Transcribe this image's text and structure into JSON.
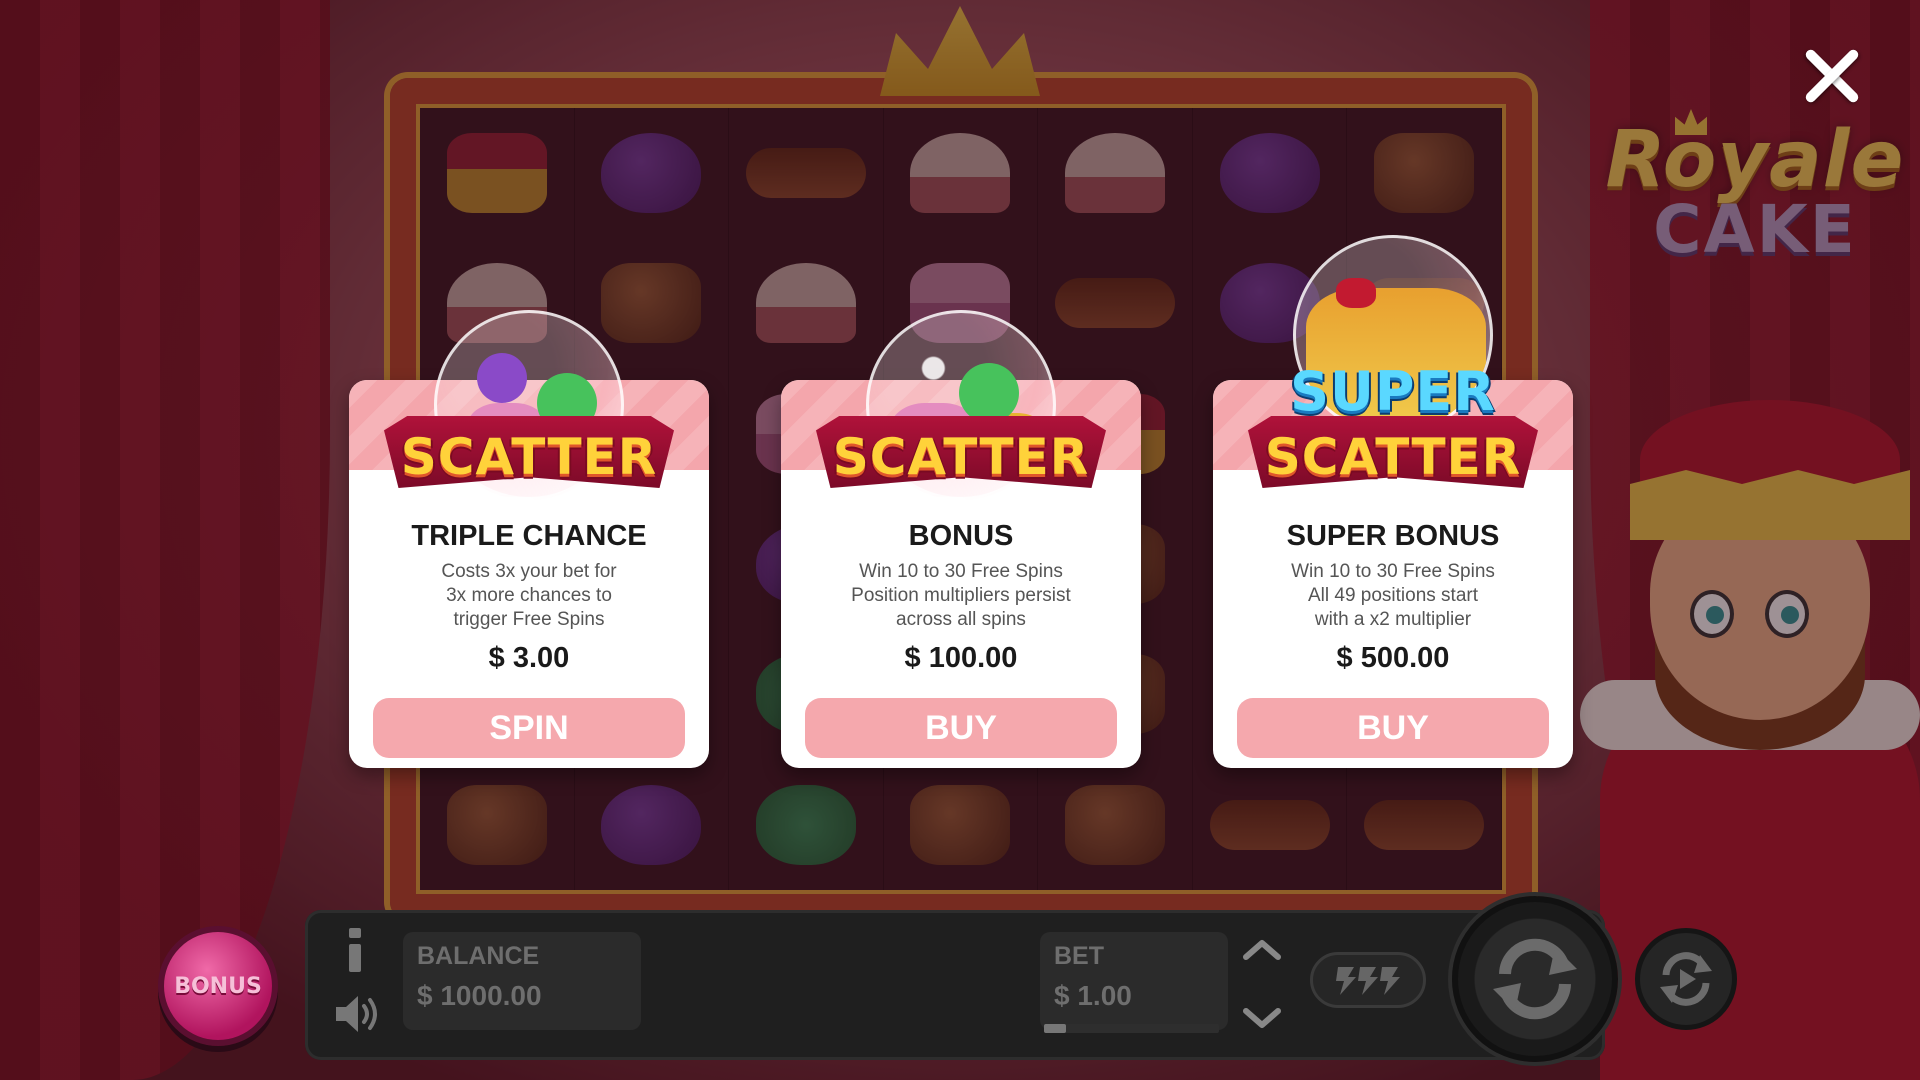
{
  "game": {
    "logo_line1": "Royale",
    "logo_line2": "CAKE"
  },
  "popup": {
    "close_icon": "close-icon",
    "cards": [
      {
        "badge": "SCATTER",
        "title": "TRIPLE CHANCE",
        "description_lines": [
          "Costs 3x your bet for",
          "3x more chances to",
          "trigger Free Spins"
        ],
        "price": "$ 3.00",
        "action_label": "SPIN"
      },
      {
        "badge": "SCATTER",
        "title": "BONUS",
        "description_lines": [
          "Win 10 to 30 Free Spins",
          "Position multipliers persist",
          "across all spins"
        ],
        "price": "$ 100.00",
        "action_label": "BUY"
      },
      {
        "badge_top": "SUPER",
        "badge": "SCATTER",
        "title": "SUPER BONUS",
        "description_lines": [
          "Win 10 to 30 Free Spins",
          "All 49 positions start",
          "with a x2 multiplier"
        ],
        "price": "$ 500.00",
        "action_label": "BUY"
      }
    ]
  },
  "controls": {
    "bonus_button_label": "BONUS",
    "balance_label": "BALANCE",
    "balance_value": "$ 1000.00",
    "bet_label": "BET",
    "bet_value": "$ 1.00",
    "icons": [
      "info-icon",
      "sound-icon",
      "bet-up-icon",
      "bet-down-icon",
      "turbo-icon",
      "spin-icon",
      "autoplay-icon"
    ]
  },
  "colors": {
    "card_button": "#f5a8ad",
    "card_background": "#ffffff",
    "bar_background": "#1f1f1f",
    "bar_text": "#6e6e6e",
    "bonus_button": "#d3237a"
  }
}
